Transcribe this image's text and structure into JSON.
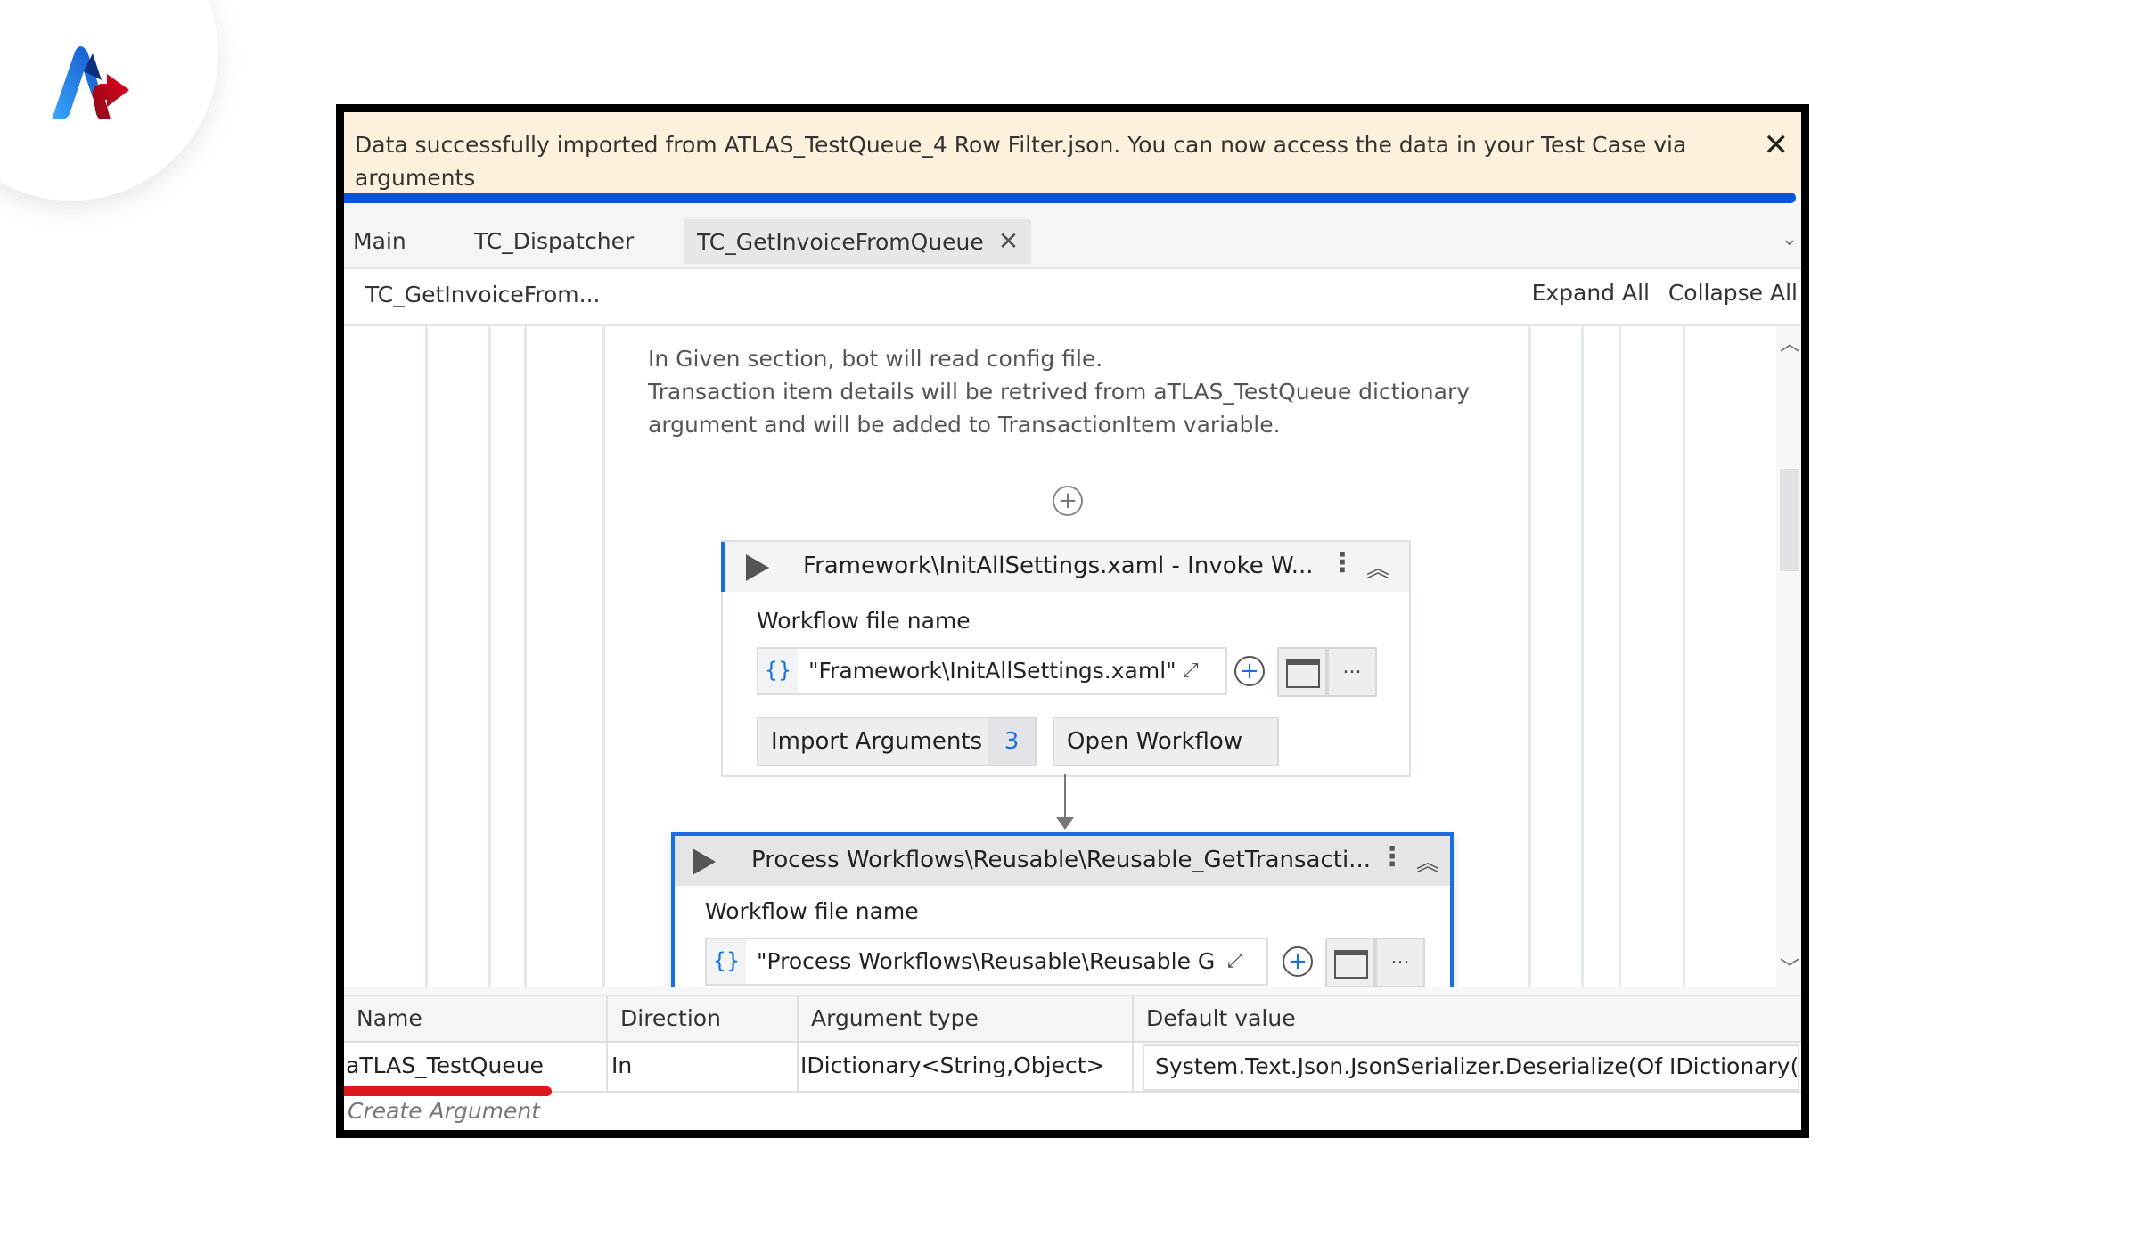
{
  "logo": {
    "name": "atlas-logo"
  },
  "banner": {
    "message": "Data successfully imported from ATLAS_TestQueue_4 Row Filter.json. You can now access the data in your Test Case via arguments",
    "close_label": "✕",
    "progress": 1.0,
    "accent_color": "#0a55e0"
  },
  "tabs": [
    {
      "label": "Main",
      "active": false
    },
    {
      "label": "TC_Dispatcher",
      "active": false
    },
    {
      "label": "TC_GetInvoiceFromQueue",
      "active": true,
      "close_label": "✕"
    }
  ],
  "tab_overflow_icon": "⌄",
  "breadcrumb": {
    "path": "TC_GetInvoiceFrom...",
    "expand_all": "Expand All",
    "collapse_all": "Collapse All"
  },
  "canvas": {
    "annotation_lines": [
      "In Given section, bot will read config file.",
      "Transaction item details will be retrived from aTLAS_TestQueue dictionary",
      "argument and will be added to TransactionItem variable."
    ],
    "add_icon": "+",
    "activities": [
      {
        "title": "Framework\\InitAllSettings.xaml - Invoke W...",
        "field_label": "Workflow file name",
        "brace": "{}",
        "value": "\"Framework\\InitAllSettings.xaml\"",
        "import_label": "Import Arguments",
        "import_count": "3",
        "open_label": "Open Workflow",
        "more_label": "...",
        "kebab": "⋮",
        "collapse": "︽"
      },
      {
        "title": "Process Workflows\\Reusable\\Reusable_GetTransacti...",
        "field_label": "Workflow file name",
        "brace": "{}",
        "value": "\"Process Workflows\\Reusable\\Reusable G",
        "more_label": "...",
        "kebab": "⋮",
        "collapse": "︽"
      }
    ],
    "scroll_up": "︿",
    "scroll_down": "﹀"
  },
  "arguments": {
    "columns": [
      "Name",
      "Direction",
      "Argument type",
      "Default value"
    ],
    "rows": [
      {
        "name": "aTLAS_TestQueue",
        "direction": "In",
        "type": "IDictionary<String,Object>",
        "default": "System.Text.Json.JsonSerializer.Deserialize(Of IDictionary( C"
      }
    ],
    "create_placeholder": "Create Argument",
    "highlight_color": "#e0161d"
  }
}
